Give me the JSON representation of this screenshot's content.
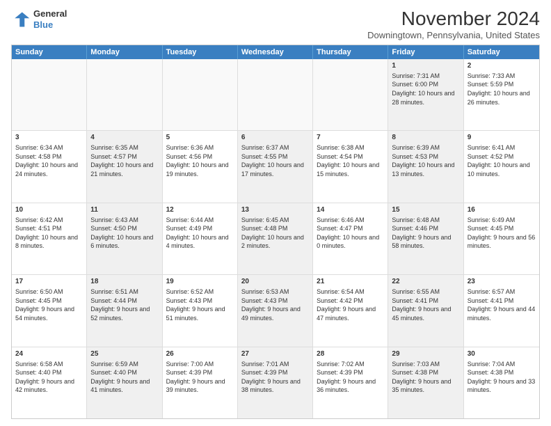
{
  "logo": {
    "line1": "General",
    "line2": "Blue"
  },
  "title": "November 2024",
  "location": "Downingtown, Pennsylvania, United States",
  "header_days": [
    "Sunday",
    "Monday",
    "Tuesday",
    "Wednesday",
    "Thursday",
    "Friday",
    "Saturday"
  ],
  "weeks": [
    [
      {
        "day": "",
        "info": "",
        "shaded": false,
        "empty": true
      },
      {
        "day": "",
        "info": "",
        "shaded": false,
        "empty": true
      },
      {
        "day": "",
        "info": "",
        "shaded": false,
        "empty": true
      },
      {
        "day": "",
        "info": "",
        "shaded": false,
        "empty": true
      },
      {
        "day": "",
        "info": "",
        "shaded": false,
        "empty": true
      },
      {
        "day": "1",
        "info": "Sunrise: 7:31 AM\nSunset: 6:00 PM\nDaylight: 10 hours and 28 minutes.",
        "shaded": true,
        "empty": false
      },
      {
        "day": "2",
        "info": "Sunrise: 7:33 AM\nSunset: 5:59 PM\nDaylight: 10 hours and 26 minutes.",
        "shaded": false,
        "empty": false
      }
    ],
    [
      {
        "day": "3",
        "info": "Sunrise: 6:34 AM\nSunset: 4:58 PM\nDaylight: 10 hours and 24 minutes.",
        "shaded": false,
        "empty": false
      },
      {
        "day": "4",
        "info": "Sunrise: 6:35 AM\nSunset: 4:57 PM\nDaylight: 10 hours and 21 minutes.",
        "shaded": true,
        "empty": false
      },
      {
        "day": "5",
        "info": "Sunrise: 6:36 AM\nSunset: 4:56 PM\nDaylight: 10 hours and 19 minutes.",
        "shaded": false,
        "empty": false
      },
      {
        "day": "6",
        "info": "Sunrise: 6:37 AM\nSunset: 4:55 PM\nDaylight: 10 hours and 17 minutes.",
        "shaded": true,
        "empty": false
      },
      {
        "day": "7",
        "info": "Sunrise: 6:38 AM\nSunset: 4:54 PM\nDaylight: 10 hours and 15 minutes.",
        "shaded": false,
        "empty": false
      },
      {
        "day": "8",
        "info": "Sunrise: 6:39 AM\nSunset: 4:53 PM\nDaylight: 10 hours and 13 minutes.",
        "shaded": true,
        "empty": false
      },
      {
        "day": "9",
        "info": "Sunrise: 6:41 AM\nSunset: 4:52 PM\nDaylight: 10 hours and 10 minutes.",
        "shaded": false,
        "empty": false
      }
    ],
    [
      {
        "day": "10",
        "info": "Sunrise: 6:42 AM\nSunset: 4:51 PM\nDaylight: 10 hours and 8 minutes.",
        "shaded": false,
        "empty": false
      },
      {
        "day": "11",
        "info": "Sunrise: 6:43 AM\nSunset: 4:50 PM\nDaylight: 10 hours and 6 minutes.",
        "shaded": true,
        "empty": false
      },
      {
        "day": "12",
        "info": "Sunrise: 6:44 AM\nSunset: 4:49 PM\nDaylight: 10 hours and 4 minutes.",
        "shaded": false,
        "empty": false
      },
      {
        "day": "13",
        "info": "Sunrise: 6:45 AM\nSunset: 4:48 PM\nDaylight: 10 hours and 2 minutes.",
        "shaded": true,
        "empty": false
      },
      {
        "day": "14",
        "info": "Sunrise: 6:46 AM\nSunset: 4:47 PM\nDaylight: 10 hours and 0 minutes.",
        "shaded": false,
        "empty": false
      },
      {
        "day": "15",
        "info": "Sunrise: 6:48 AM\nSunset: 4:46 PM\nDaylight: 9 hours and 58 minutes.",
        "shaded": true,
        "empty": false
      },
      {
        "day": "16",
        "info": "Sunrise: 6:49 AM\nSunset: 4:45 PM\nDaylight: 9 hours and 56 minutes.",
        "shaded": false,
        "empty": false
      }
    ],
    [
      {
        "day": "17",
        "info": "Sunrise: 6:50 AM\nSunset: 4:45 PM\nDaylight: 9 hours and 54 minutes.",
        "shaded": false,
        "empty": false
      },
      {
        "day": "18",
        "info": "Sunrise: 6:51 AM\nSunset: 4:44 PM\nDaylight: 9 hours and 52 minutes.",
        "shaded": true,
        "empty": false
      },
      {
        "day": "19",
        "info": "Sunrise: 6:52 AM\nSunset: 4:43 PM\nDaylight: 9 hours and 51 minutes.",
        "shaded": false,
        "empty": false
      },
      {
        "day": "20",
        "info": "Sunrise: 6:53 AM\nSunset: 4:43 PM\nDaylight: 9 hours and 49 minutes.",
        "shaded": true,
        "empty": false
      },
      {
        "day": "21",
        "info": "Sunrise: 6:54 AM\nSunset: 4:42 PM\nDaylight: 9 hours and 47 minutes.",
        "shaded": false,
        "empty": false
      },
      {
        "day": "22",
        "info": "Sunrise: 6:55 AM\nSunset: 4:41 PM\nDaylight: 9 hours and 45 minutes.",
        "shaded": true,
        "empty": false
      },
      {
        "day": "23",
        "info": "Sunrise: 6:57 AM\nSunset: 4:41 PM\nDaylight: 9 hours and 44 minutes.",
        "shaded": false,
        "empty": false
      }
    ],
    [
      {
        "day": "24",
        "info": "Sunrise: 6:58 AM\nSunset: 4:40 PM\nDaylight: 9 hours and 42 minutes.",
        "shaded": false,
        "empty": false
      },
      {
        "day": "25",
        "info": "Sunrise: 6:59 AM\nSunset: 4:40 PM\nDaylight: 9 hours and 41 minutes.",
        "shaded": true,
        "empty": false
      },
      {
        "day": "26",
        "info": "Sunrise: 7:00 AM\nSunset: 4:39 PM\nDaylight: 9 hours and 39 minutes.",
        "shaded": false,
        "empty": false
      },
      {
        "day": "27",
        "info": "Sunrise: 7:01 AM\nSunset: 4:39 PM\nDaylight: 9 hours and 38 minutes.",
        "shaded": true,
        "empty": false
      },
      {
        "day": "28",
        "info": "Sunrise: 7:02 AM\nSunset: 4:39 PM\nDaylight: 9 hours and 36 minutes.",
        "shaded": false,
        "empty": false
      },
      {
        "day": "29",
        "info": "Sunrise: 7:03 AM\nSunset: 4:38 PM\nDaylight: 9 hours and 35 minutes.",
        "shaded": true,
        "empty": false
      },
      {
        "day": "30",
        "info": "Sunrise: 7:04 AM\nSunset: 4:38 PM\nDaylight: 9 hours and 33 minutes.",
        "shaded": false,
        "empty": false
      }
    ]
  ]
}
